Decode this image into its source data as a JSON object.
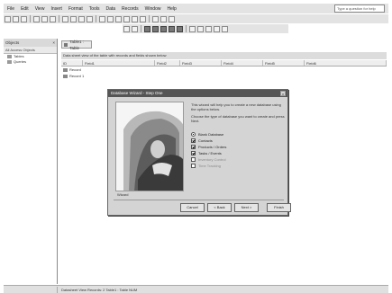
{
  "menubar": {
    "items": [
      "File",
      "Edit",
      "View",
      "Insert",
      "Format",
      "Tools",
      "Data",
      "Records",
      "Window",
      "Help"
    ],
    "help_placeholder": "Type a question for help"
  },
  "left_pane": {
    "title": "Objects",
    "subtitle": "All Access Objects",
    "tree": [
      "Tables",
      "Queries"
    ]
  },
  "main_pane": {
    "tab_label": "Table1 : Table",
    "description": "Data sheet view of the table with records and fields shown below",
    "columns": [
      "ID",
      "Field1",
      "Field2",
      "Field3",
      "Field4",
      "Field5",
      "Field6"
    ],
    "rows": [
      "Record",
      "Record 1"
    ]
  },
  "dialog": {
    "title": "Database Wizard - Step One",
    "intro": "This wizard will help you to create a new database using the options below.",
    "instructions": "Choose the type of database you want to create and press Next.",
    "options": [
      {
        "label": "Blank Database",
        "kind": "radio",
        "selected": true,
        "dim": false
      },
      {
        "label": "Contacts",
        "kind": "check",
        "selected": true,
        "dim": false
      },
      {
        "label": "Products / Orders",
        "kind": "check",
        "selected": true,
        "dim": false
      },
      {
        "label": "Tasks / Events",
        "kind": "check",
        "selected": true,
        "dim": false
      },
      {
        "label": "Inventory Control",
        "kind": "check",
        "selected": false,
        "dim": true
      },
      {
        "label": "Time Tracking",
        "kind": "check",
        "selected": false,
        "dim": true
      }
    ],
    "image_label": "Wizard",
    "buttons": {
      "cancel": "Cancel",
      "back": "< Back",
      "next": "Next >",
      "finish": "Finish"
    }
  },
  "statusbar": {
    "text": "Datasheet View   Records: 2   Table1 : Table   NUM"
  }
}
